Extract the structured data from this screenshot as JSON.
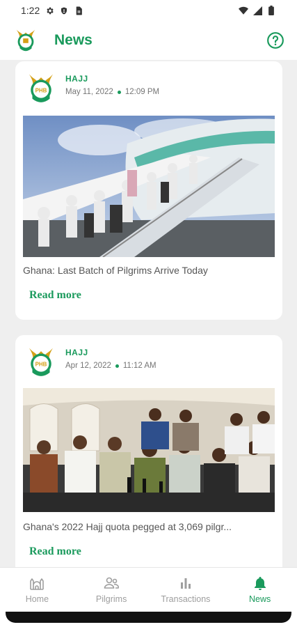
{
  "status_bar": {
    "time": "1:22"
  },
  "app_bar": {
    "title": "News"
  },
  "posts": [
    {
      "category": "HAJJ",
      "date": "May 11, 2022",
      "time": "12:09 PM",
      "headline": "Ghana: Last Batch of Pilgrims Arrive Today",
      "read_more": "Read more"
    },
    {
      "category": "HAJJ",
      "date": "Apr 12, 2022",
      "time": "11:12 AM",
      "headline": "Ghana's 2022 Hajj quota pegged at 3,069 pilgr...",
      "read_more": "Read more"
    }
  ],
  "nav": {
    "items": [
      {
        "label": "Home",
        "icon": "mosque-icon"
      },
      {
        "label": "Pilgrims",
        "icon": "people-icon"
      },
      {
        "label": "Transactions",
        "icon": "bar-chart-icon"
      },
      {
        "label": "News",
        "icon": "bell-icon"
      }
    ],
    "active": "News"
  },
  "colors": {
    "accent": "#1a9a5c",
    "inactive": "#9e9e9e"
  }
}
